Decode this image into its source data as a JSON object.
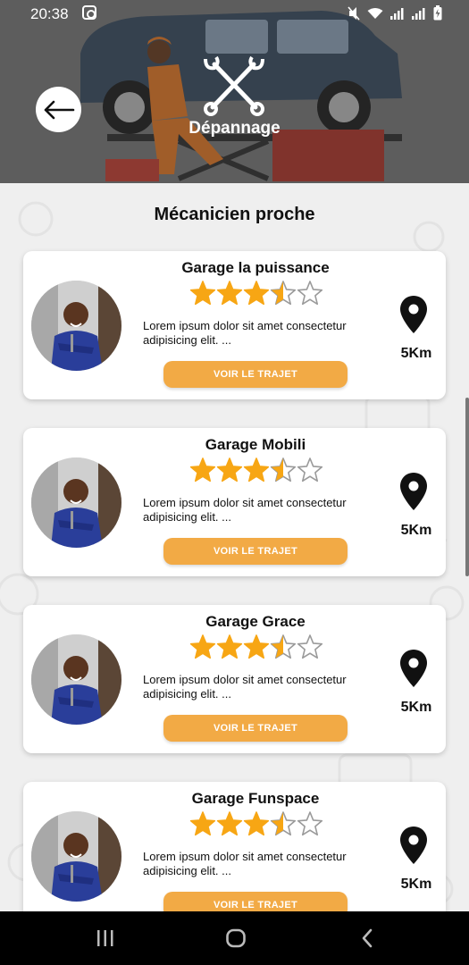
{
  "status_bar": {
    "time": "20:38"
  },
  "header": {
    "title": "Dépannage"
  },
  "section": {
    "title": "Mécanicien proche"
  },
  "garages": [
    {
      "name": "Garage la puissance",
      "rating": 3.5,
      "max_rating": 5,
      "description": "Lorem ipsum dolor sit amet consectetur adipisicing elit. ...",
      "button": "VOIR LE TRAJET",
      "distance": "5Km"
    },
    {
      "name": "Garage Mobili",
      "rating": 3.5,
      "max_rating": 5,
      "description": "Lorem ipsum dolor sit amet consectetur adipisicing elit. ...",
      "button": "VOIR LE TRAJET",
      "distance": "5Km"
    },
    {
      "name": "Garage Grace",
      "rating": 3.5,
      "max_rating": 5,
      "description": "Lorem ipsum dolor sit amet consectetur adipisicing elit. ...",
      "button": "VOIR LE TRAJET",
      "distance": "5Km"
    },
    {
      "name": "Garage Funspace",
      "rating": 3.5,
      "max_rating": 5,
      "description": "Lorem ipsum dolor sit amet consectetur adipisicing elit. ...",
      "button": "VOIR LE TRAJET",
      "distance": "5Km"
    }
  ],
  "colors": {
    "accent": "#f2aa45",
    "star": "#f7a614",
    "star_empty": "#9a9a9a"
  },
  "icons": {
    "back": "arrow-left-icon",
    "header": "crossed-wrenches-icon",
    "location": "map-pin-icon"
  }
}
